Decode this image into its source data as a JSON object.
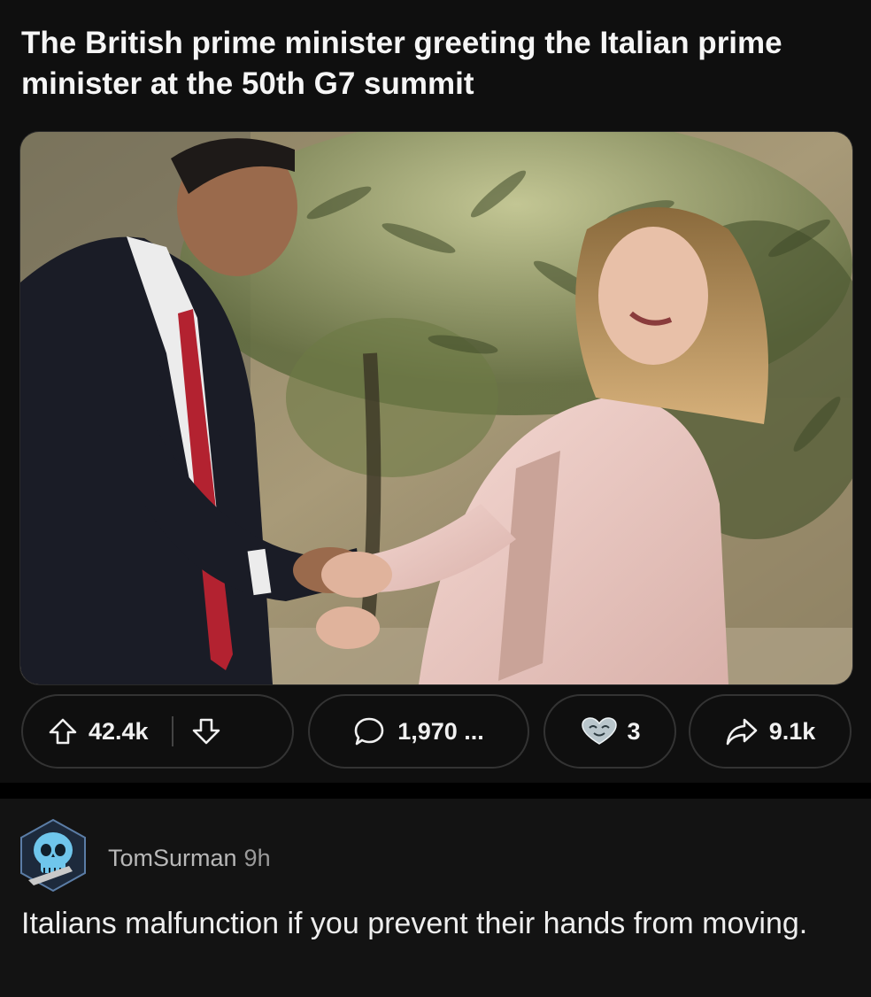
{
  "post": {
    "title": "The British prime minister greeting the Italian prime minister at the 50th G7 summit"
  },
  "actions": {
    "upvote_icon": "arrow-up-outline-icon",
    "downvote_icon": "arrow-down-outline-icon",
    "vote_count": "42.4k",
    "comment_icon": "speech-bubble-icon",
    "comment_count": "1,970 ...",
    "award_icon": "heart-award-icon",
    "award_count": "3",
    "share_icon": "share-arrow-icon",
    "share_count": "9.1k"
  },
  "comment": {
    "avatar_icon": "skull-avatar-icon",
    "username": "TomSurman",
    "time": "9h",
    "body": "Italians malfunction if you prevent their hands from moving."
  },
  "colors": {
    "background": "#0f0f0f",
    "comment_background": "#131313",
    "pill_border": "#333333",
    "text": "#f2f2f2",
    "muted_text": "#b8b8b8"
  }
}
